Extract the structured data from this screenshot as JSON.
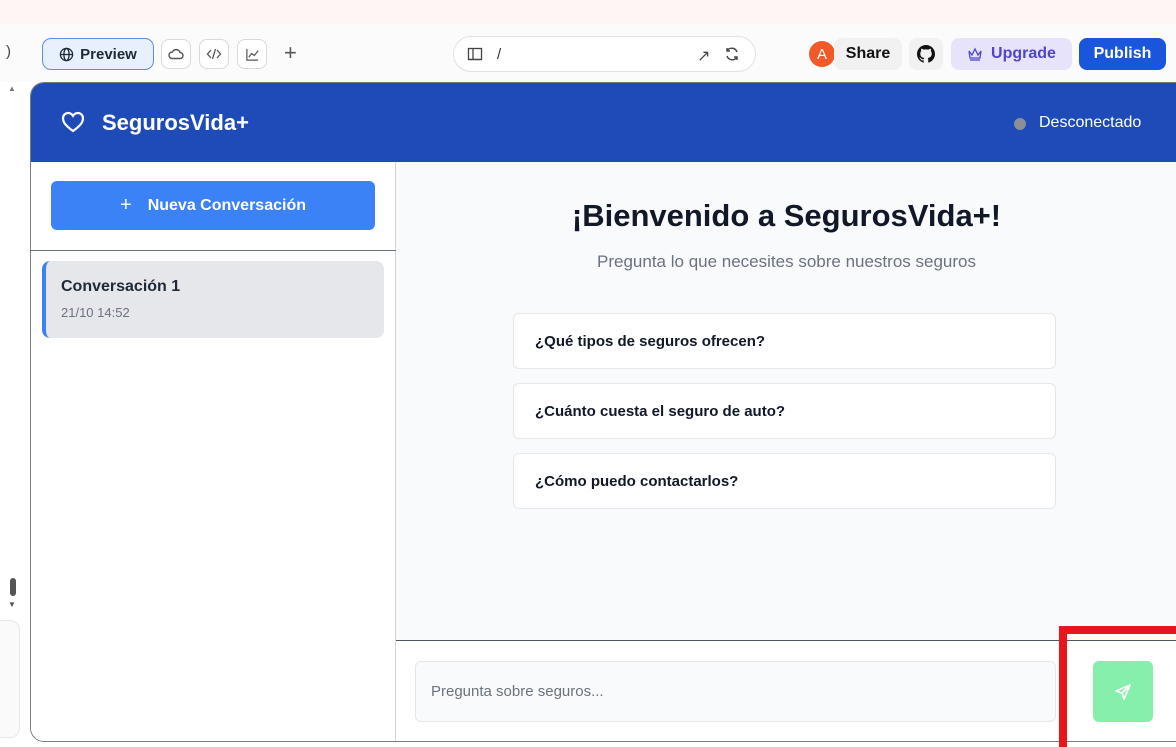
{
  "toolbar": {
    "left_paren": ")",
    "preview_label": "Preview",
    "plus": "+",
    "url_path": "/",
    "avatar_letter": "A",
    "share_label": "Share",
    "upgrade_label": "Upgrade",
    "publish_label": "Publish"
  },
  "app": {
    "brand": "SegurosVida+",
    "status": "Desconectado",
    "sidebar": {
      "new_conversation": "Nueva Conversación",
      "conversations": [
        {
          "title": "Conversación 1",
          "time": "21/10 14:52"
        }
      ]
    },
    "main": {
      "title": "¡Bienvenido a SegurosVida+!",
      "subtitle": "Pregunta lo que necesites sobre nuestros seguros",
      "suggestions": [
        "¿Qué tipos de seguros ofrecen?",
        "¿Cuánto cuesta el seguro de auto?",
        "¿Cómo puedo contactarlos?"
      ],
      "input_placeholder": "Pregunta sobre seguros..."
    }
  },
  "colors": {
    "header_bg": "#1e4bb8",
    "new_conv_bg": "#3b82f6",
    "send_bg": "#86efac",
    "publish_bg": "#1a56db",
    "highlight": "#e8151b"
  }
}
